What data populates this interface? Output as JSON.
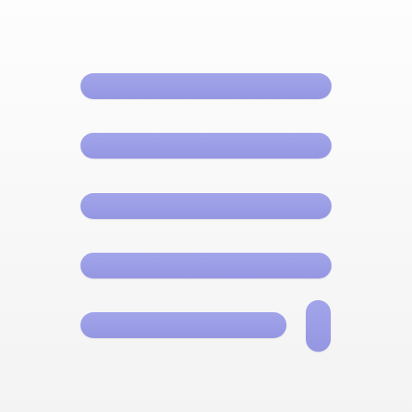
{
  "icon": {
    "name": "text-document-cursor-icon",
    "colors": {
      "background_top": "#fdfdfd",
      "background_bottom": "#f3f3f3",
      "line": "#a3a5ea",
      "line_edge": "#9496e2"
    },
    "line_count": 5
  }
}
